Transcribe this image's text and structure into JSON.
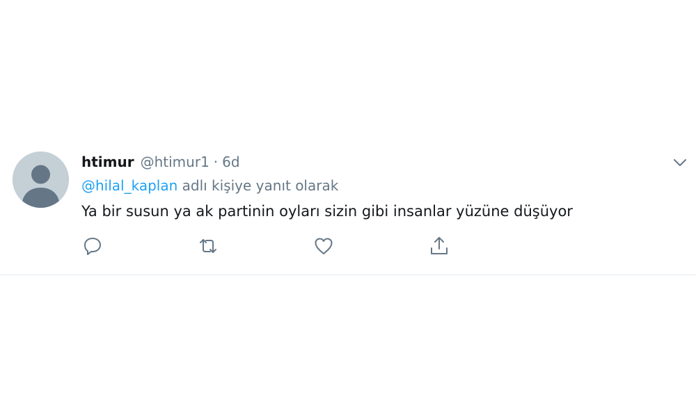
{
  "tweet": {
    "display_name": "htimur",
    "handle": "@htimur1",
    "separator": "·",
    "time": "6d",
    "reply_mention": "@hilal_kaplan",
    "reply_suffix": " adlı kişiye yanıt olarak",
    "text": "Ya bir susun ya ak partinin oyları sizin gibi insanlar yüzüne düşüyor"
  },
  "icons": {
    "avatar": "default-avatar-icon",
    "more": "chevron-down-icon",
    "reply": "reply-icon",
    "retweet": "retweet-icon",
    "like": "heart-icon",
    "share": "share-icon"
  },
  "colors": {
    "text": "#14171a",
    "secondary": "#657786",
    "link": "#1da1f2",
    "avatar_bg": "#c4cfd6",
    "avatar_fg": "#657786",
    "divider": "#e6ecf0"
  }
}
